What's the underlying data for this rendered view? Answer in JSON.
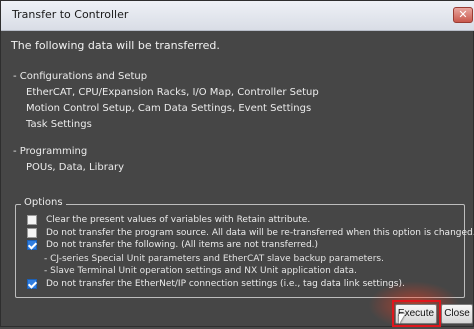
{
  "window": {
    "title": "Transfer to Controller",
    "close_icon": "close-icon"
  },
  "intro": "The following data will be transferred.",
  "config": {
    "heading": "- Configurations and Setup",
    "lines": [
      "EtherCAT, CPU/Expansion Racks, I/O Map, Controller Setup",
      "Motion Control Setup, Cam Data Settings, Event Settings",
      "Task Settings"
    ]
  },
  "programming": {
    "heading": "- Programming",
    "lines": [
      "POUs, Data, Library"
    ]
  },
  "options": {
    "legend": "Options",
    "items": [
      {
        "label": "Clear the present values of variables with Retain attribute.",
        "checked": false
      },
      {
        "label": "Do not transfer the program source. All data will be re-transferred when this option is changed.",
        "checked": false
      },
      {
        "label": "Do not transfer the following. (All items are not transferred.)",
        "checked": true
      },
      {
        "label": "Do not transfer the EtherNet/IP connection settings (i.e., tag data link settings).",
        "checked": true
      }
    ],
    "sub_lines": [
      "- CJ-series Special Unit parameters and EtherCAT slave backup parameters.",
      "- Slave Terminal Unit operation settings and NX Unit application data."
    ]
  },
  "buttons": {
    "execute": "Execute",
    "close": "Close"
  },
  "colors": {
    "highlight": "#e0161d",
    "checkbox_checked": "#2f7de0"
  }
}
